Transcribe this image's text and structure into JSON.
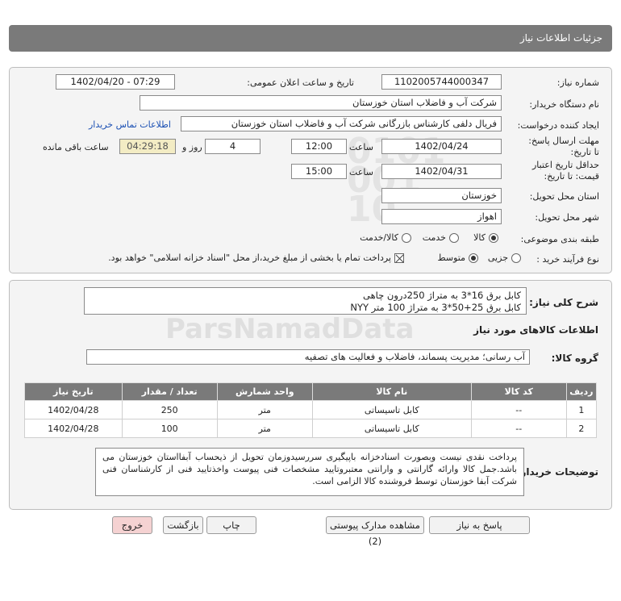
{
  "header": {
    "title": "جزئیات اطلاعات نیاز"
  },
  "form": {
    "need_number_label": "شماره نیاز:",
    "need_number": "1102005744000347",
    "announce_label": "تاریخ و ساعت اعلان عمومی:",
    "announce_value": "1402/04/20 - 07:29",
    "buyer_org_label": "نام دستگاه خریدار:",
    "buyer_org": "شرکت آب و فاضلاب استان خوزستان",
    "creator_label": "ایجاد کننده درخواست:",
    "creator": "فریال دلفی کارشناس بازرگانی شرکت آب و فاضلاب استان خوزستان",
    "contact_link": "اطلاعات تماس خریدار",
    "reply_deadline_label": "مهلت ارسال پاسخ: تا تاریخ:",
    "reply_date": "1402/04/24",
    "time_label": "ساعت",
    "reply_time": "12:00",
    "days": "4",
    "days_label": "روز و",
    "remaining_time": "04:29:18",
    "remaining_label": "ساعت باقی مانده",
    "price_validity_label": "حداقل تاریخ اعتبار قیمت: تا تاریخ:",
    "price_date": "1402/04/31",
    "price_time_label": "ساعت",
    "price_time": "15:00",
    "province_label": "استان محل تحویل:",
    "province": "خوزستان",
    "city_label": "شهر محل تحویل:",
    "city": "اهواز",
    "category_label": "طبقه بندی موضوعی:",
    "category_options": [
      "کالا",
      "خدمت",
      "کالا/خدمت"
    ],
    "process_label": "نوع فرآیند خرید :",
    "process_options": [
      "جزیی",
      "متوسط"
    ],
    "payment_note": "پرداخت تمام یا بخشی از مبلغ خرید،از محل \"اسناد خزانه اسلامی\" خواهد بود."
  },
  "description": {
    "label": "شرح کلی نیاز:",
    "line1": "کابل برق 16*3 به متراژ 250درون چاهی",
    "line2": "کابل برق 25+50*3 به متراژ 100 متر  NYY"
  },
  "goods": {
    "section_title": "اطلاعات کالاهای مورد نیاز",
    "group_label": "گروه کالا:",
    "group_value": "آب رسانی؛ مدیریت پسماند، فاضلاب و فعالیت های تصفیه",
    "columns": [
      "ردیف",
      "کد کالا",
      "نام کالا",
      "واحد شمارش",
      "تعداد / مقدار",
      "تاریخ نیاز"
    ],
    "rows": [
      {
        "row": "1",
        "code": "--",
        "name": "کابل تاسیساتی",
        "unit": "متر",
        "qty": "250",
        "date": "1402/04/28"
      },
      {
        "row": "2",
        "code": "--",
        "name": "کابل تاسیساتی",
        "unit": "متر",
        "qty": "100",
        "date": "1402/04/28"
      }
    ]
  },
  "buyer_notes": {
    "label": "توضیحات خریدار:",
    "text": "پرداخت نقدی نیست وبصورت اسنادخزانه باپیگیری سررسیدوزمان تحویل از ذیحساب آبفااستان خوزستان می باشد.جمل کالا وارائه گارانتی و وارانتی معتبروتایید مشخصات فنی پیوست واخذتایید فنی از کارشناسان فنی شرکت آبفا خوزستان توسط فروشنده کالا الزامی است."
  },
  "buttons": {
    "reply": "پاسخ به نیاز",
    "attachments": "مشاهده مدارک پیوستی (2)",
    "print": "چاپ",
    "back": "بازگشت",
    "exit": "خروج"
  },
  "colors": {
    "header": "#7a7a7a",
    "link": "#1a4fb3",
    "exit_button": "#f5d2d2",
    "remaining_box": "#f3ecc4"
  }
}
